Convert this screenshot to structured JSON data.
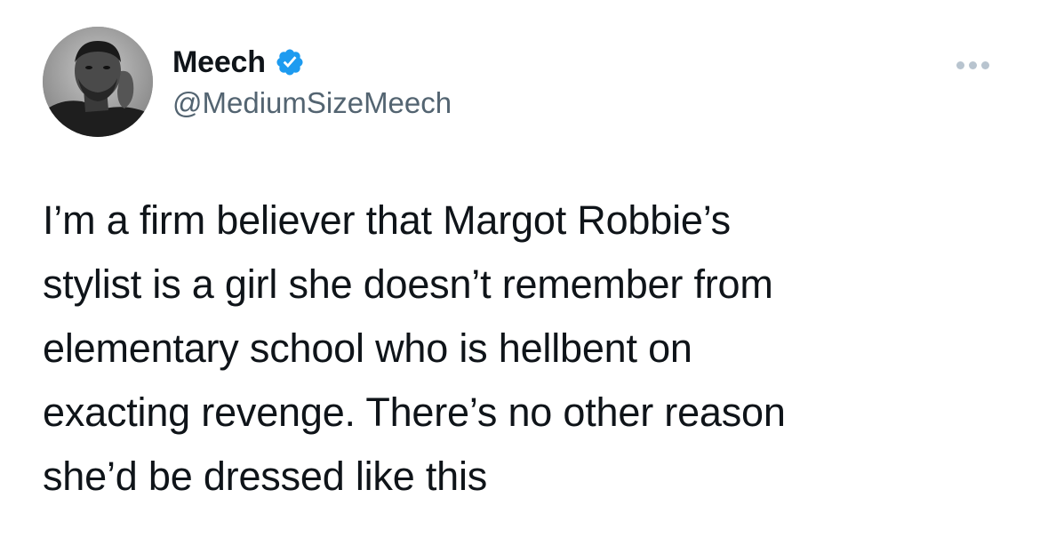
{
  "author": {
    "display_name": "Meech",
    "handle": "@MediumSizeMeech",
    "verified": true,
    "avatar_icon": "profile-photo"
  },
  "menu": {
    "icon": "more-options-icon"
  },
  "tweet": {
    "text": "I’m a firm believer that Margot Robbie’s\nstylist is a girl she doesn’t remember from\nelementary school who is hellbent on\nexacting revenge. There’s no other reason\nshe’d be dressed like this"
  },
  "colors": {
    "text_primary": "#0f1419",
    "text_secondary": "#536471",
    "verified_blue": "#1d9bf0",
    "more_dots": "#b8c4cf",
    "background": "#ffffff"
  }
}
